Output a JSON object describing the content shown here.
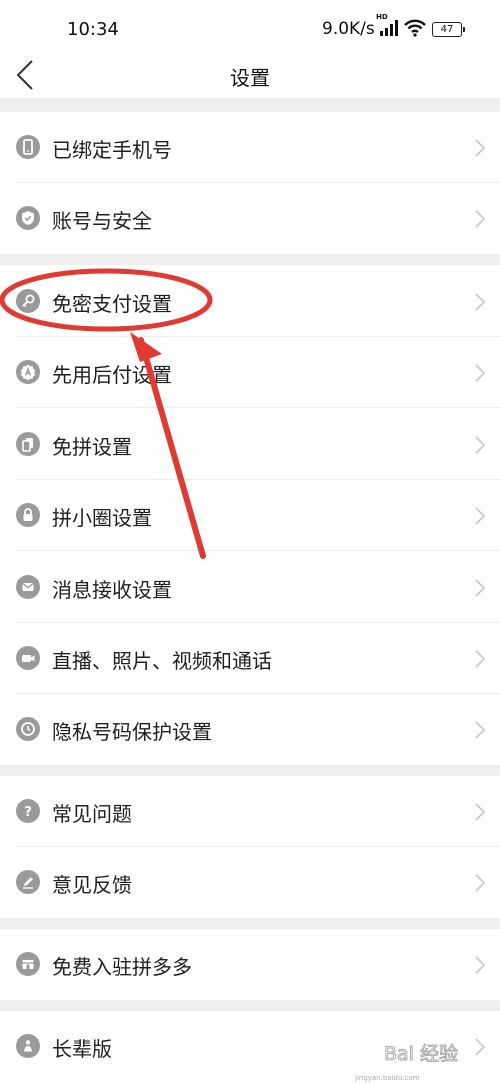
{
  "status_bar": {
    "time": "10:34",
    "network_speed": "9.0K/s",
    "hd_badge": "HD",
    "battery_level": "47"
  },
  "nav": {
    "title": "设置"
  },
  "groups": [
    {
      "items": [
        {
          "label": "已绑定手机号",
          "icon": "phone-icon"
        },
        {
          "label": "账号与安全",
          "icon": "shield-icon"
        }
      ]
    },
    {
      "items": [
        {
          "label": "免密支付设置",
          "icon": "key-icon"
        },
        {
          "label": "先用后付设置",
          "icon": "badge-a-icon"
        },
        {
          "label": "免拼设置",
          "icon": "cards-icon"
        },
        {
          "label": "拼小圈设置",
          "icon": "lock-icon"
        },
        {
          "label": "消息接收设置",
          "icon": "envelope-icon"
        },
        {
          "label": "直播、照片、视频和通话",
          "icon": "video-camera-icon"
        },
        {
          "label": "隐私号码保护设置",
          "icon": "phone-clock-icon"
        }
      ]
    },
    {
      "items": [
        {
          "label": "常见问题",
          "icon": "question-icon"
        },
        {
          "label": "意见反馈",
          "icon": "pencil-icon"
        }
      ]
    },
    {
      "items": [
        {
          "label": "免费入驻拼多多",
          "icon": "store-icon"
        }
      ]
    },
    {
      "items": [
        {
          "label": "长辈版",
          "icon": "elder-icon"
        }
      ]
    }
  ],
  "annotation": {
    "highlight_color": "#e03a32",
    "highlighted_item": "免密支付设置"
  },
  "watermark": {
    "text": "Bai 经验",
    "url": "jingyan.baidu.com"
  }
}
